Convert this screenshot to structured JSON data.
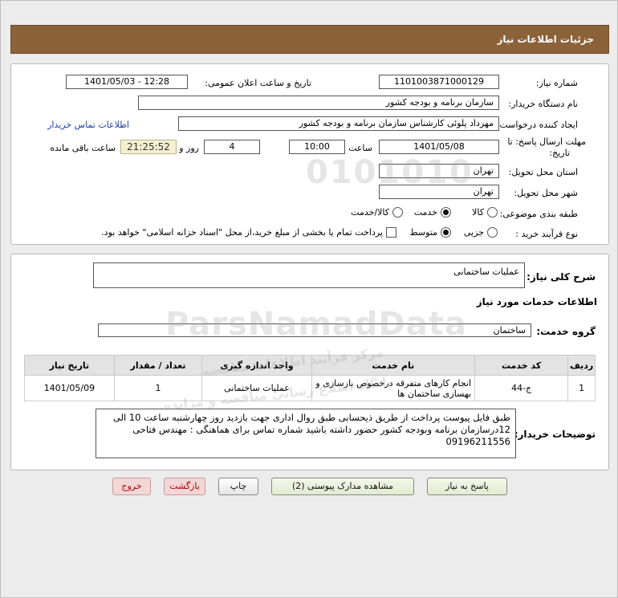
{
  "header": {
    "title": "جزئیات اطلاعات نیاز"
  },
  "fields": {
    "need_number_label": "شماره نیاز:",
    "need_number": "1101003871000129",
    "announce_label": "تاریخ و ساعت اعلان عمومی:",
    "announce_value": "1401/05/03 - 12:28",
    "buyer_org_label": "نام دستگاه خریدار:",
    "buyer_org": "سازمان برنامه و بودجه کشور",
    "requester_label": "ایجاد کننده درخواست:",
    "requester": "مهرداد پلوئی کارشناس سازمان برنامه و بودجه کشور",
    "contact_link": "اطلاعات تماس خریدار",
    "deadline_label_1": "مهلت ارسال پاسخ: تا",
    "deadline_label_2": "تاریخ:",
    "deadline_date": "1401/05/08",
    "time_label": "ساعت",
    "deadline_time": "10:00",
    "days_value": "4",
    "days_label": "روز و",
    "countdown": "21:25:52",
    "remaining_label": "ساعت باقی مانده",
    "province_label": "استان محل تحویل:",
    "province": "تهران",
    "city_label": "شهر محل تحویل:",
    "city": "تهران",
    "category_label": "طبقه بندی موضوعی:",
    "category_options": [
      "کالا",
      "خدمت",
      "کالا/خدمت"
    ],
    "category_selected": "خدمت",
    "process_label": "نوع فرآیند خرید :",
    "process_options": [
      "جزیی",
      "متوسط"
    ],
    "process_selected": "متوسط",
    "payment_note": "پرداخت تمام یا بخشی از مبلغ خرید،از محل \"اسناد خزانه اسلامی\" خواهد بود."
  },
  "summary": {
    "label": "شرح کلی نیاز:",
    "value": "عملیات ساختمانی",
    "services_title": "اطلاعات خدمات مورد نیاز",
    "group_label": "گروه خدمت:",
    "group_value": "ساختمان"
  },
  "table": {
    "headers": [
      "ردیف",
      "کد خدمت",
      "نام خدمت",
      "واحد اندازه گیری",
      "تعداد / مقدار",
      "تاریخ نیاز"
    ],
    "rows": [
      [
        "1",
        "ج-44",
        "انجام کارهای متفرقه درخصوص بازسازی و بهسازی ساختمان ها",
        "عملیات ساختمانی",
        "1",
        "1401/05/09"
      ]
    ]
  },
  "buyer_notes": {
    "label": "توضیحات خریدار:",
    "text": "طبق فایل پیوست پرداخت از طریق ذیحسابی طبق روال اداری جهت بازدید روز چهارشنبه ساعت 10 الی 12درسازمان برنامه وبودجه کشور حضور داشته باشید شماره تماس برای  هماهنگی : مهندس فتاحی 09196211556"
  },
  "buttons": {
    "reply": "پاسخ به نیاز",
    "view_docs": "مشاهده مدارک پیوستی (2)",
    "print": "چاپ",
    "back": "بازگشت",
    "exit": "خروج"
  },
  "watermark": {
    "digits": "0101010",
    "brand": "ParsNamadData",
    "fa_line1": "مرکز فرآیند اطلاعات مناقصه",
    "fa_line2": "پایگاه اطلاع رسانی مناقصه و مزایده"
  }
}
